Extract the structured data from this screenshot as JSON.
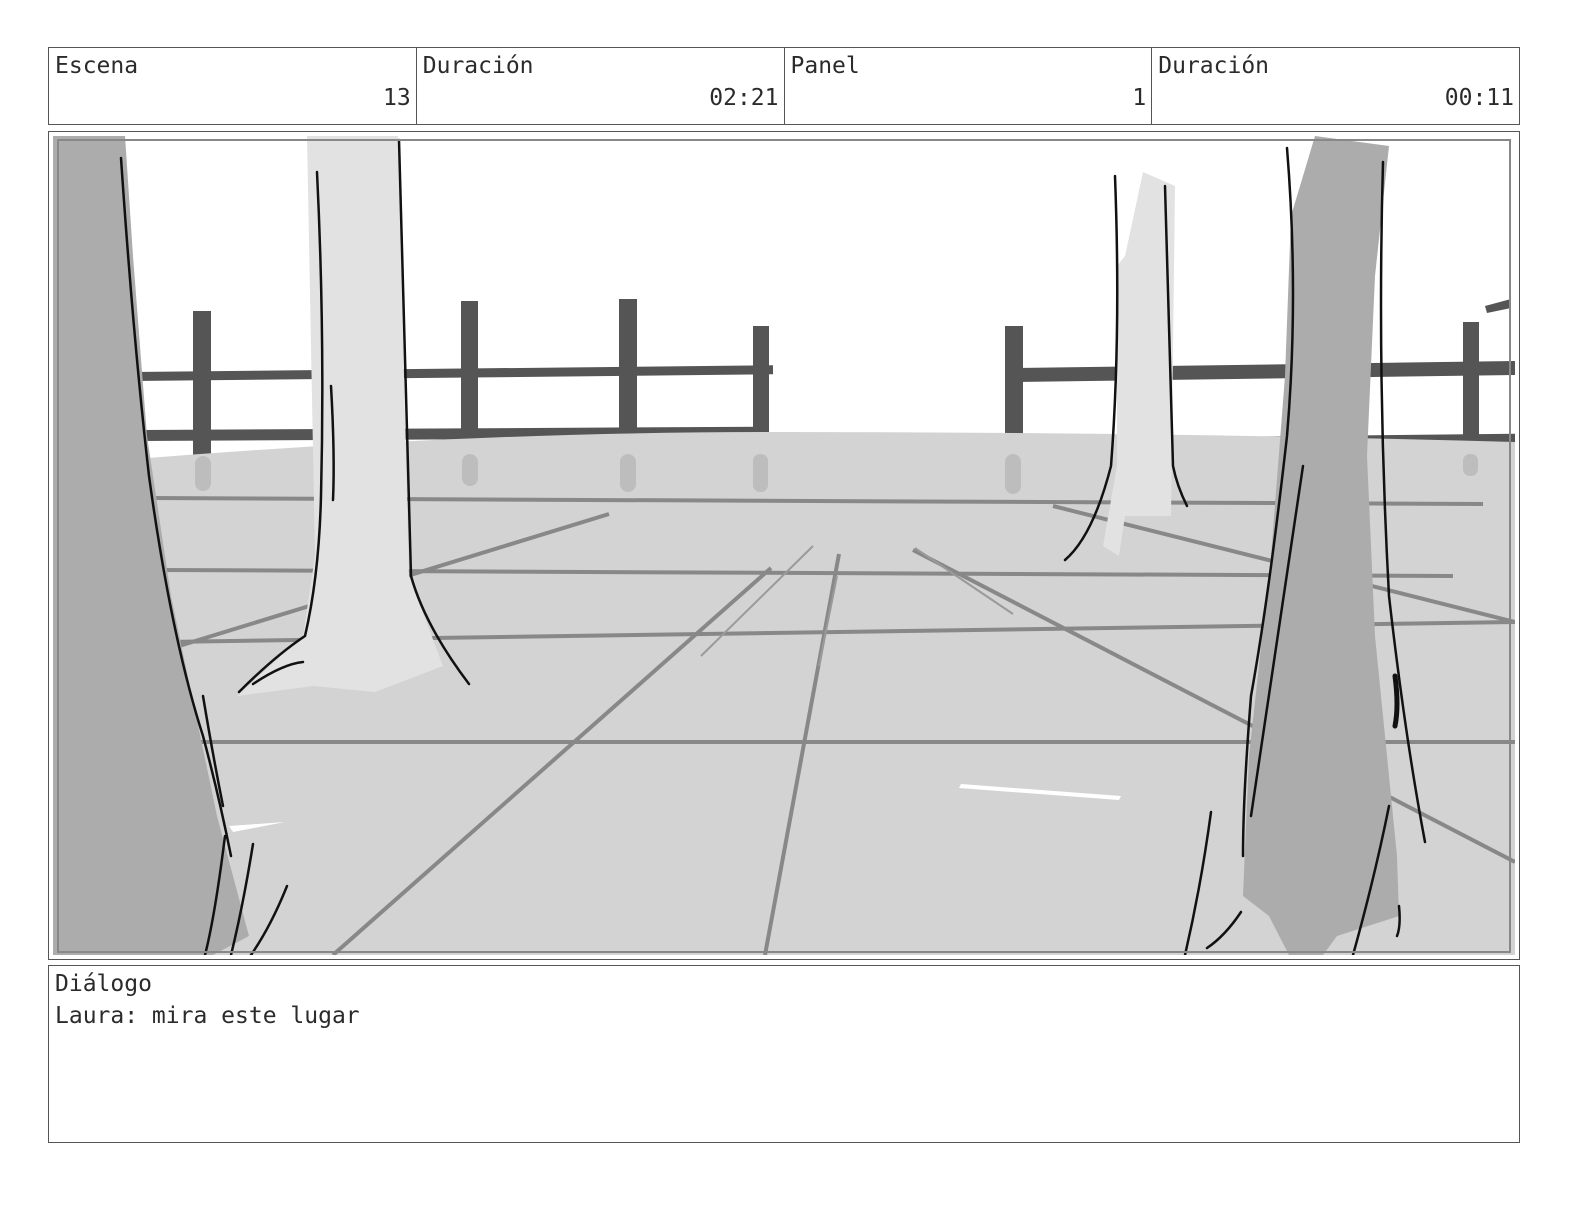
{
  "header": {
    "cells": [
      {
        "label": "Escena",
        "value": "13"
      },
      {
        "label": "Duración",
        "value": "02:21"
      },
      {
        "label": "Panel",
        "value": "1"
      },
      {
        "label": "Duración",
        "value": "00:11"
      }
    ]
  },
  "panel": {
    "content": "storyboard-sketch"
  },
  "dialog": {
    "label": "Diálogo",
    "text": "Laura: mira este lugar"
  }
}
